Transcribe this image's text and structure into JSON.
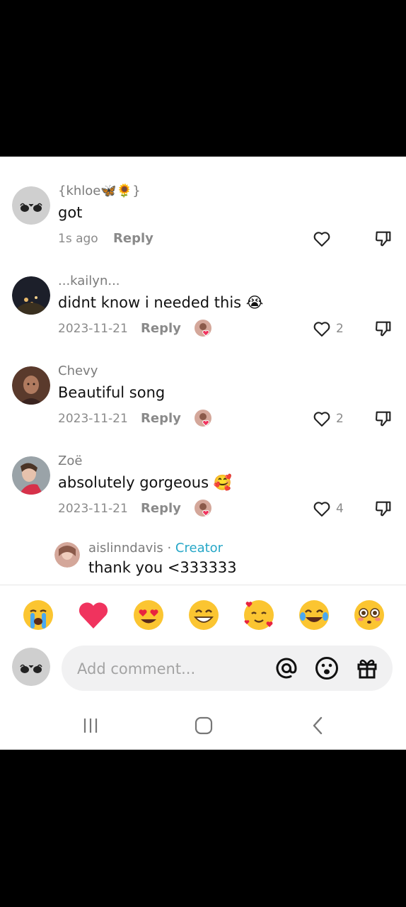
{
  "comments": [
    {
      "username": "{khloe🦋🌻}",
      "text": "got",
      "date": "1s ago",
      "reply_label": "Reply",
      "likes": "",
      "creator_liked": false
    },
    {
      "username": "...kailyn...",
      "text": "didnt know i needed this 😭",
      "date": "2023-11-21",
      "reply_label": "Reply",
      "likes": "2",
      "creator_liked": true
    },
    {
      "username": "Chevy",
      "text": "Beautiful song",
      "date": "2023-11-21",
      "reply_label": "Reply",
      "likes": "2",
      "creator_liked": true
    },
    {
      "username": "Zoë",
      "text": "absolutely gorgeous 🥰",
      "date": "2023-11-21",
      "reply_label": "Reply",
      "likes": "4",
      "creator_liked": true
    }
  ],
  "creator_reply": {
    "username": "aislinndavis",
    "separator": "·",
    "badge": "Creator",
    "text": "thank you <333333"
  },
  "emoji_bar": [
    "😭",
    "❤️",
    "😍",
    "😁",
    "🥰",
    "😂",
    "😳"
  ],
  "composer": {
    "placeholder": "Add comment...",
    "icons": [
      "mention-icon",
      "emoji-icon",
      "gift-icon"
    ]
  },
  "nav_bar": [
    "recent-apps-icon",
    "home-icon",
    "back-icon"
  ],
  "colors": {
    "creator_badge": "#26a7c7",
    "heart_emoji": "#f0335e",
    "text_secondary": "#8a8a8a"
  }
}
